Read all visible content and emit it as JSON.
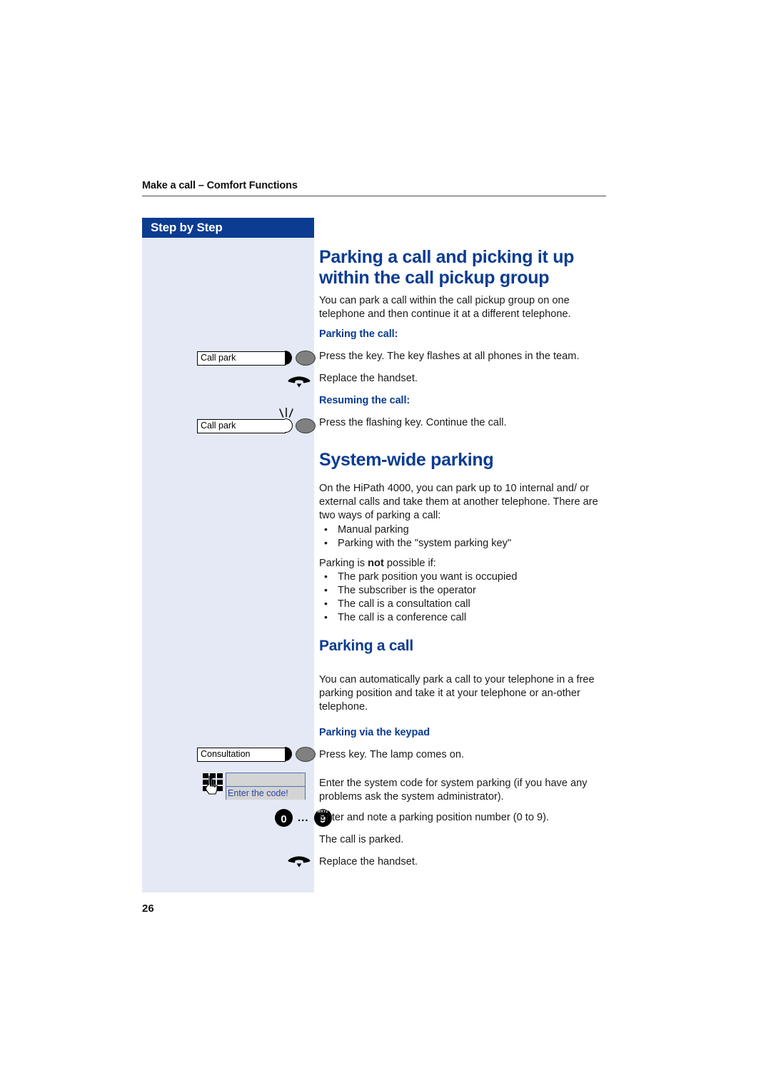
{
  "header": {
    "running_head": "Make a call – Comfort Functions"
  },
  "sidebar": {
    "title": "Step by Step",
    "items": [
      {
        "type": "function-key",
        "label": "Call park",
        "led_state": "on",
        "icon": "function-key-icon"
      },
      {
        "type": "handset",
        "icon": "handset-onhook-icon"
      },
      {
        "type": "function-key",
        "label": "Call park",
        "led_state": "flashing",
        "icon": "function-key-flashing-icon"
      },
      {
        "type": "function-key",
        "label": "Consultation",
        "led_state": "on",
        "icon": "function-key-icon"
      },
      {
        "type": "keypad-display",
        "icon": "keypad-hand-icon",
        "display_line_1": "",
        "display_line_2": "Enter the code!"
      },
      {
        "type": "digit-range",
        "from": "0",
        "from_sub": "",
        "to": "9",
        "to_sub": "WXYZ",
        "separator": "..."
      },
      {
        "type": "handset",
        "icon": "handset-onhook-icon"
      }
    ]
  },
  "content": {
    "section1": {
      "heading": "Parking a call and picking it up within the call pickup group",
      "intro": "You can park a call within the call pickup group on one telephone and then continue it at a different telephone.",
      "sub1": "Parking the call:",
      "step1": "Press the key. The key flashes at all phones in the team.",
      "step2": "Replace the handset.",
      "sub2": "Resuming the call:",
      "step3": "Press the flashing key. Continue the call."
    },
    "section2": {
      "heading": "System-wide parking",
      "para1": "On the HiPath 4000, you can park up to 10 internal and/ or external calls and take them at another telephone. There are two ways of parking a call:",
      "list1": [
        "Manual parking",
        "Parking with the \"system parking key\""
      ],
      "para2_prefix": "Parking is ",
      "para2_bold": "not",
      "para2_suffix": " possible if:",
      "list2": [
        "The park position you want is occupied",
        "The subscriber is the operator",
        "The call is a consultation call",
        "The call is a conference call"
      ]
    },
    "section3": {
      "heading": "Parking a call",
      "para1": "You can automatically park a call to your telephone in a free parking position and take it at your telephone or an-other telephone.",
      "sub1": "Parking via the keypad",
      "step1": "Press key. The lamp comes on.",
      "step2": "Enter the system code for system parking (if you have any problems ask the system administrator).",
      "step3": "Enter and note a parking position number (0 to 9).",
      "step4": "The call is parked.",
      "step5": "Replace the handset."
    }
  },
  "footer": {
    "page_number": "26"
  },
  "colors": {
    "brand_blue": "#0b3c91",
    "sidebar_bg": "#e4e9f5",
    "text": "#1a1a1a",
    "lcd_border": "#4a6fb5",
    "lcd_bg": "#d4d4d4",
    "lcd_text": "#2a46a8"
  }
}
